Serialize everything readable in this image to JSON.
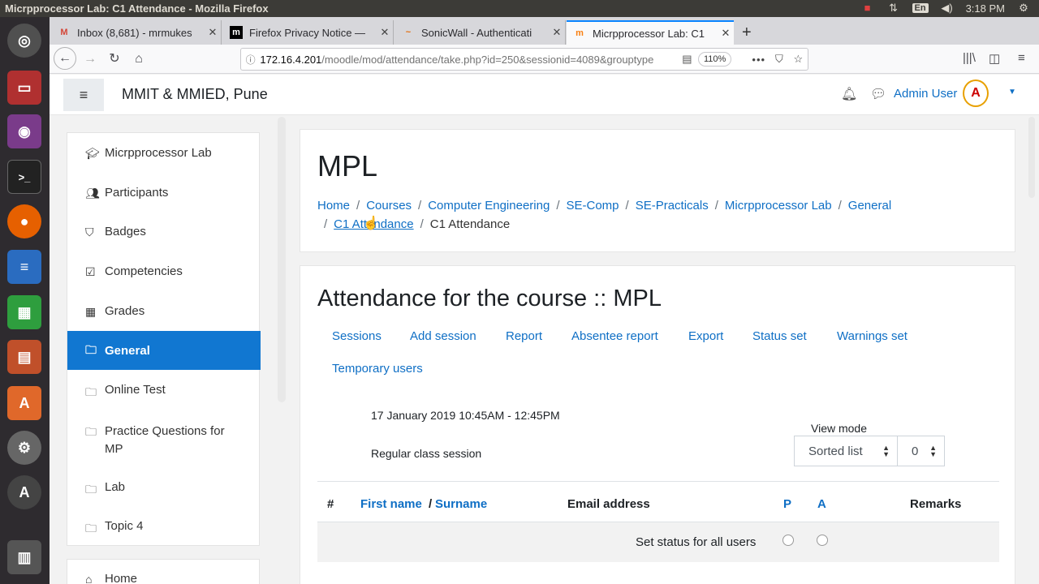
{
  "os": {
    "window_title": "Micrpprocessor Lab: C1 Attendance - Mozilla Firefox",
    "lang": "En",
    "time": "3:18 PM"
  },
  "browser": {
    "tabs": [
      {
        "label": "Inbox (8,681) - mrmukes",
        "fav": "M"
      },
      {
        "label": "Firefox Privacy Notice —",
        "fav": "m"
      },
      {
        "label": "SonicWall - Authenticati",
        "fav": "~"
      },
      {
        "label": "Micrpprocessor Lab: C1",
        "fav": "m"
      }
    ],
    "url_host": "172.16.4.201",
    "url_path": "/moodle/mod/attendance/take.php?id=250&sessionid=4089&grouptype",
    "zoom": "110%"
  },
  "moodle": {
    "site_name": "MMIT & MMIED, Pune",
    "user_name": "Admin User",
    "avatar_letter": "A"
  },
  "drawer": {
    "items": [
      {
        "label": "Micrpprocessor Lab",
        "icon": "graduation-cap-icon"
      },
      {
        "label": "Participants",
        "icon": "users-icon"
      },
      {
        "label": "Badges",
        "icon": "shield-icon"
      },
      {
        "label": "Competencies",
        "icon": "check-square-icon"
      },
      {
        "label": "Grades",
        "icon": "table-icon"
      },
      {
        "label": "General",
        "icon": "folder-icon",
        "active": true
      },
      {
        "label": "Online Test",
        "icon": "folder-icon"
      },
      {
        "label": "Practice Questions for MP",
        "icon": "folder-icon"
      },
      {
        "label": "Lab",
        "icon": "folder-icon"
      },
      {
        "label": "Topic 4",
        "icon": "folder-icon"
      }
    ],
    "home_label": "Home"
  },
  "header": {
    "course_title": "MPL",
    "breadcrumbs": [
      "Home",
      "Courses",
      "Computer Engineering",
      "SE-Comp",
      "SE-Practicals",
      "Micrpprocessor Lab",
      "General",
      "C1 Attendance",
      "C1 Attendance"
    ]
  },
  "attendance": {
    "title": "Attendance for the course :: MPL",
    "tabs": [
      "Sessions",
      "Add session",
      "Report",
      "Absentee report",
      "Export",
      "Status set",
      "Warnings set",
      "Temporary users"
    ],
    "session_date": "17 January 2019 10:45AM - 12:45PM",
    "session_desc": "Regular class session",
    "view_mode_label": "View mode",
    "view_mode_value": "Sorted list",
    "page_value": "0",
    "columns": {
      "num": "#",
      "first_name": "First name",
      "sep": "/",
      "surname": "Surname",
      "email": "Email address",
      "p": "P",
      "a": "A",
      "remarks": "Remarks"
    },
    "set_status_label": "Set status for all users"
  },
  "colors": {
    "accent": "#1177d1",
    "link": "#0f6fc5"
  }
}
